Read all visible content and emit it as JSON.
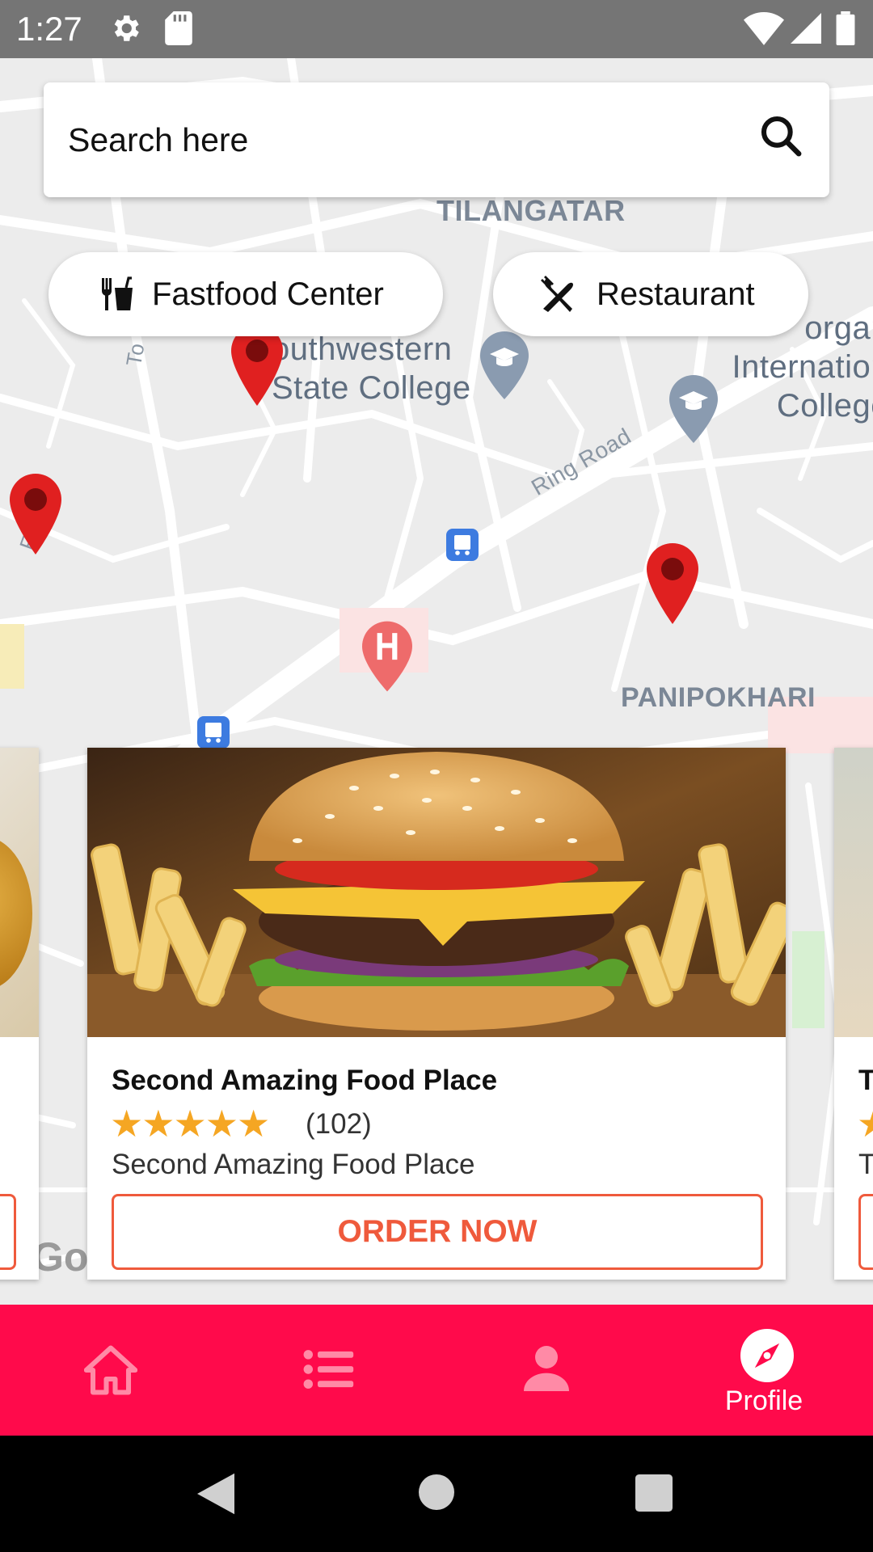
{
  "status_bar": {
    "time": "1:27"
  },
  "map": {
    "labels": {
      "area_top": "TILANGATAR",
      "area_bottom": "PANIPOKHARI",
      "college1_line1": "outhwestern",
      "college1_line2": "State College",
      "college2_line1": "organ",
      "college2_line2": "Internation",
      "college2_line3": "College",
      "road": "Ring Road",
      "road_left": "To",
      "road_left2": "Fe",
      "attribution": "Goo"
    }
  },
  "search": {
    "placeholder": "Search here"
  },
  "filters": [
    {
      "label": "Fastfood Center",
      "icon": "fastfood-icon"
    },
    {
      "label": "Restaurant",
      "icon": "restaurant-icon"
    }
  ],
  "cards": {
    "current": {
      "title": "Second Amazing Food Place",
      "stars": "★★★★★",
      "rating": 5,
      "reviews": "(102)",
      "subtitle": "Second Amazing Food Place",
      "button": "ORDER NOW"
    },
    "next": {
      "title_partial": "T",
      "subtitle_partial": "T"
    }
  },
  "bottom_nav": {
    "items": [
      {
        "icon": "home-icon",
        "label": ""
      },
      {
        "icon": "list-icon",
        "label": ""
      },
      {
        "icon": "person-icon",
        "label": ""
      },
      {
        "icon": "compass-icon",
        "label": "Profile"
      }
    ],
    "active_index": 3
  },
  "colors": {
    "accent": "#ff0a4b",
    "order": "#ef5a3c",
    "star": "#f5a623",
    "pin": "#e02020"
  }
}
